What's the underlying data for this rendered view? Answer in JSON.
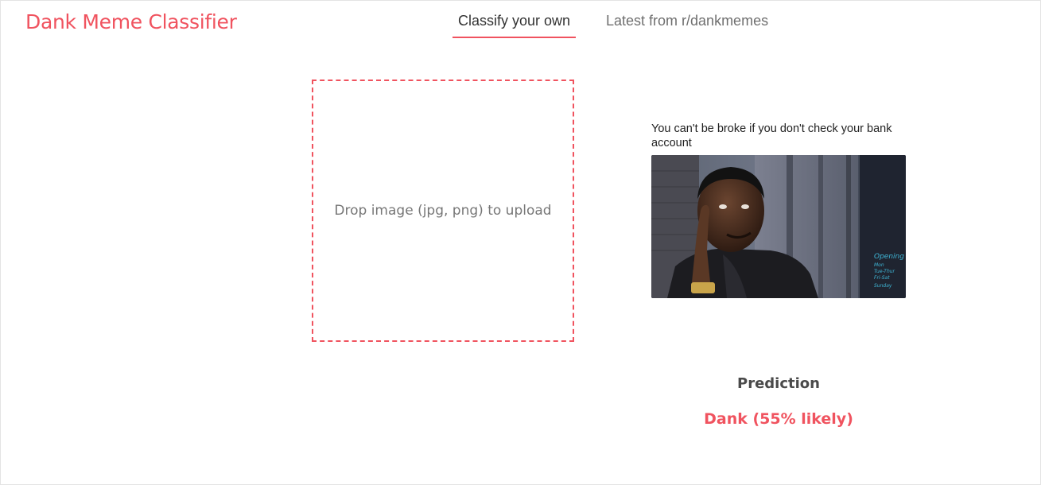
{
  "header": {
    "app_title": "Dank Meme Classifier",
    "tabs": [
      {
        "label": "Classify your own",
        "active": true
      },
      {
        "label": "Latest from r/dankmemes",
        "active": false
      }
    ]
  },
  "upload": {
    "prompt": "Drop image (jpg, png) to upload"
  },
  "result": {
    "caption": "You can't be broke if you don't check your bank account",
    "image_description": "roll-safe-meme-image",
    "sign_text": [
      "Opening",
      "Mon",
      "Tue-Thur",
      "Fri-Sat",
      "Sunday"
    ],
    "prediction_label": "Prediction",
    "prediction_value": "Dank (55% likely)"
  },
  "colors": {
    "accent": "#f0535f",
    "text_muted": "#777777",
    "text_dark": "#333333"
  }
}
